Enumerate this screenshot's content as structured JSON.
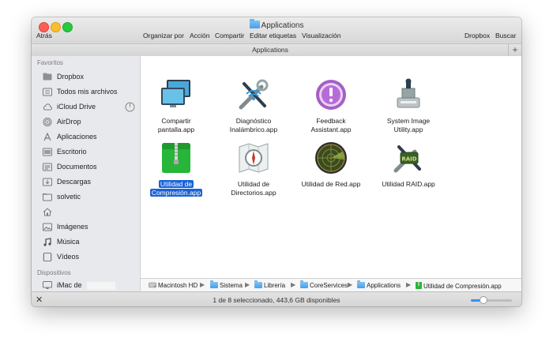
{
  "window": {
    "title": "Applications",
    "traffic_lights": [
      "close",
      "minimize",
      "zoom"
    ]
  },
  "toolbar": {
    "back": "Atrás",
    "arrange": "Organizar por",
    "action": "Acción",
    "share": "Compartir",
    "tags": "Editar etiquetas",
    "view": "Visualización",
    "dropbox": "Dropbox",
    "search": "Buscar"
  },
  "pathheader": {
    "title": "Applications",
    "plus": "+"
  },
  "sidebar": {
    "favorites_header": "Favoritos",
    "favorites": [
      {
        "label": "Dropbox",
        "icon": "dropbox-icon"
      },
      {
        "label": "Todos mis archivos",
        "icon": "all-files-icon"
      },
      {
        "label": "iCloud Drive",
        "icon": "cloud-icon"
      },
      {
        "label": "AirDrop",
        "icon": "airdrop-icon"
      },
      {
        "label": "Aplicaciones",
        "icon": "apps-icon"
      },
      {
        "label": "Escritorio",
        "icon": "desktop-icon"
      },
      {
        "label": "Documentos",
        "icon": "documents-icon"
      },
      {
        "label": "Descargas",
        "icon": "downloads-icon"
      },
      {
        "label": "solvetic",
        "icon": "folder-icon"
      },
      {
        "label": "",
        "icon": "home-icon"
      },
      {
        "label": "Imágenes",
        "icon": "images-icon"
      },
      {
        "label": "Música",
        "icon": "music-icon"
      },
      {
        "label": "Vídeos",
        "icon": "videos-icon"
      }
    ],
    "devices_header": "Dispositivos",
    "devices": [
      {
        "label": "iMac de",
        "icon": "imac-icon"
      }
    ]
  },
  "files": [
    {
      "name": "Compartir pantalla.app",
      "line1": "Compartir",
      "line2": "pantalla.app",
      "icon": "screen-sharing-icon",
      "selected": false
    },
    {
      "name": "Diagnóstico Inalámbrico.app",
      "line1": "Diagnóstico",
      "line2": "Inalámbrico.app",
      "icon": "wireless-diagnostics-icon",
      "selected": false
    },
    {
      "name": "Feedback Assistant.app",
      "line1": "Feedback",
      "line2": "Assistant.app",
      "icon": "feedback-assistant-icon",
      "selected": false
    },
    {
      "name": "System Image Utility.app",
      "line1": "System Image",
      "line2": "Utility.app",
      "icon": "system-image-utility-icon",
      "selected": false
    },
    {
      "name": "Utilidad de Compresión.app",
      "line1": "Utilidad de",
      "line2": "Compresión.app",
      "icon": "archive-utility-icon",
      "selected": true
    },
    {
      "name": "Utilidad de Directorios.app",
      "line1": "Utilidad de",
      "line2": "Directorios.app",
      "icon": "directory-utility-icon",
      "selected": false
    },
    {
      "name": "Utilidad de Red.app",
      "line1": "Utilidad de Red.app",
      "line2": "",
      "icon": "network-utility-icon",
      "selected": false
    },
    {
      "name": "Utilidad RAID.app",
      "line1": "Utilidad RAID.app",
      "line2": "",
      "icon": "raid-utility-icon",
      "selected": false
    }
  ],
  "pathbar": [
    {
      "label": "Macintosh HD",
      "icon": "disk-icon"
    },
    {
      "label": "Sistema",
      "icon": "folder-icon"
    },
    {
      "label": "Librería",
      "icon": "folder-icon"
    },
    {
      "label": "CoreServices",
      "icon": "folder-icon"
    },
    {
      "label": "Applications",
      "icon": "folder-icon"
    },
    {
      "label": "Utilidad de Compresión.app",
      "icon": "archive-utility-icon"
    }
  ],
  "pathbar_separator": "▶",
  "status": {
    "text": "1 de 8 seleccionado, 443,6 GB disponibles",
    "icon_size_fraction": 0.3
  },
  "colors": {
    "selection": "#1b63d6",
    "archive_green": "#27b53a",
    "folder_blue": "#5aa8ec"
  }
}
